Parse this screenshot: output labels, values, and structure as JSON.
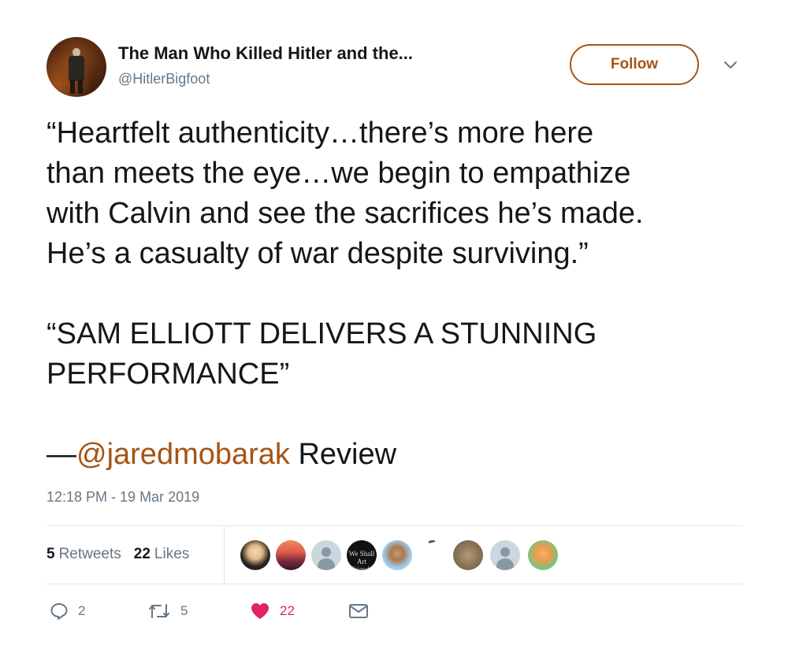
{
  "header": {
    "display_name": "The Man Who Killed Hitler and the...",
    "handle": "@HitlerBigfoot",
    "follow_label": "Follow"
  },
  "tweet": {
    "lines": [
      "“Heartfelt authenticity…there’s more here",
      "than meets the eye…we begin to empathize",
      "with Calvin and see the sacrifices he’s made.",
      "He’s a casualty of war despite surviving.”"
    ],
    "lines2": [
      "“SAM ELLIOTT DELIVERS A STUNNING",
      "PERFORMANCE”"
    ],
    "dash": "—",
    "mention": "@jaredmobarak",
    "after_mention": " Review"
  },
  "timestamp": "12:18 PM - 19 Mar 2019",
  "stats": {
    "retweets_count": "5",
    "retweets_label": "Retweets",
    "likes_count": "22",
    "likes_label": "Likes"
  },
  "likers_badge_text": "We Shall Art Friends",
  "actions": {
    "reply_count": "2",
    "retweet_count": "5",
    "like_count": "22"
  },
  "icons": [
    "chevron-down-icon",
    "reply-icon",
    "retweet-icon",
    "heart-icon",
    "mail-icon"
  ],
  "colors": {
    "accent": "#a65414",
    "like": "#e0245e",
    "secondary_text": "#657786",
    "divider": "#e1e8ed"
  }
}
